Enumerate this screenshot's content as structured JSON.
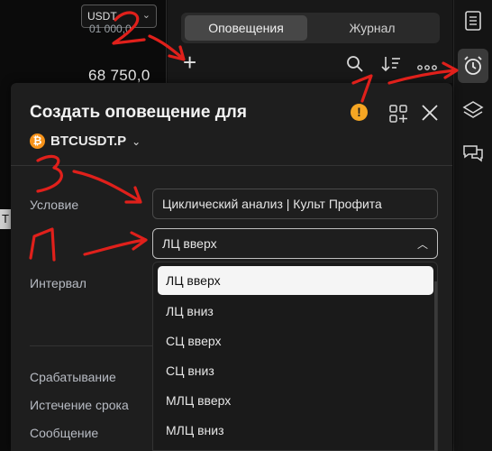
{
  "chart_side": {
    "currency": "USDT",
    "price_top": "01 000,0",
    "price": "68 750,0",
    "marker": "T"
  },
  "panel": {
    "tabs": [
      {
        "label": "Оповещения",
        "active": true
      },
      {
        "label": "Журнал",
        "active": false
      }
    ]
  },
  "dialog": {
    "title": "Создать оповещение для",
    "symbol": "BTCUSDT.P",
    "coin_glyph": "₿",
    "condition_label": "Условие",
    "condition_value": "Циклический анализ | Культ Профита",
    "second_value": "ЛЦ вверх",
    "interval_label": "Интервал",
    "trigger_label": "Срабатывание",
    "expiry_label": "Истечение срока",
    "message_label": "Сообщение"
  },
  "dropdown": {
    "options": [
      "ЛЦ вверх",
      "ЛЦ вниз",
      "СЦ вверх",
      "СЦ вниз",
      "МЛЦ вверх",
      "МЛЦ вниз"
    ],
    "selected": "ЛЦ вверх"
  },
  "annotations": {
    "color": "#e0201b",
    "labels": [
      "1",
      "2",
      "3",
      "И"
    ]
  },
  "icons": [
    "plus-icon",
    "search-icon",
    "sort-icon",
    "more-icon",
    "warning-icon",
    "add-widget-icon",
    "close-icon",
    "watchlist-icon",
    "alarm-clock-icon",
    "layers-icon",
    "chat-icon",
    "chevron-down-icon",
    "chevron-up-icon"
  ]
}
